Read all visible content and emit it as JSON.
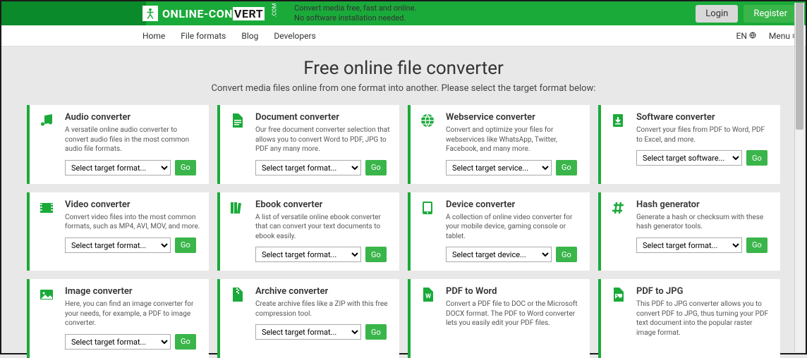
{
  "header": {
    "logo_prefix": "ONLINE-",
    "logo_con": "CON",
    "logo_vert": "VERT",
    "logo_suffix": ".COM",
    "tagline1": "Convert media free, fast and online.",
    "tagline2": "No software installation needed.",
    "login": "Login",
    "register": "Register"
  },
  "nav": {
    "home": "Home",
    "file_formats": "File formats",
    "blog": "Blog",
    "developers": "Developers",
    "lang": "EN",
    "menu": "Menu"
  },
  "hero": {
    "title": "Free online file converter",
    "subtitle": "Convert media files online from one format into another. Please select the target format below:"
  },
  "go_label": "Go",
  "cards": [
    {
      "id": "audio",
      "title": "Audio converter",
      "desc": "A versatile online audio converter to convert audio files in the most common audio file formats.",
      "placeholder": "Select target format...",
      "has_select": true
    },
    {
      "id": "document",
      "title": "Document converter",
      "desc": "Our free document converter selection that allows you to convert Word to PDF, JPG to PDF any many more.",
      "placeholder": "Select target format...",
      "has_select": true
    },
    {
      "id": "webservice",
      "title": "Webservice converter",
      "desc": "Convert and optimize your files for webservices like WhatsApp, Twitter, Facebook, and many more.",
      "placeholder": "Select target service...",
      "has_select": true
    },
    {
      "id": "software",
      "title": "Software converter",
      "desc": "Convert your files from PDF to Word, PDF to Excel, and more.",
      "placeholder": "Select target software...",
      "has_select": true
    },
    {
      "id": "video",
      "title": "Video converter",
      "desc": "Convert video files into the most common formats, such as MP4, AVI, MOV, and more.",
      "placeholder": "Select target format...",
      "has_select": true
    },
    {
      "id": "ebook",
      "title": "Ebook converter",
      "desc": "A list of versatile online ebook converter that can convert your text documents to ebook easily.",
      "placeholder": "Select target format...",
      "has_select": true
    },
    {
      "id": "device",
      "title": "Device converter",
      "desc": "A collection of online video converter for your mobile device, gaming console or tablet.",
      "placeholder": "Select target device...",
      "has_select": true
    },
    {
      "id": "hash",
      "title": "Hash generator",
      "desc": "Generate a hash or checksum with these hash generator tools.",
      "placeholder": "Select target format...",
      "has_select": true
    },
    {
      "id": "image",
      "title": "Image converter",
      "desc": "Here, you can find an image converter for your needs, for example, a PDF to image converter.",
      "placeholder": "Select target format...",
      "has_select": true
    },
    {
      "id": "archive",
      "title": "Archive converter",
      "desc": "Create archive files like a ZIP with this free compression tool.",
      "placeholder": "Select target format...",
      "has_select": true
    },
    {
      "id": "pdfword",
      "title": "PDF to Word",
      "desc": "Convert a PDF file to DOC or the Microsoft DOCX format. The PDF to Word converter lets you easily edit your PDF files.",
      "placeholder": "",
      "has_select": false
    },
    {
      "id": "pdfjpg",
      "title": "PDF to JPG",
      "desc": "This PDF to JPG converter allows you to convert PDF to JPG, thus turning your PDF text document into the popular raster image format.",
      "placeholder": "",
      "has_select": false
    }
  ],
  "icons": {
    "audio": "music-icon",
    "document": "file-icon",
    "webservice": "globe-icon",
    "software": "download-icon",
    "video": "film-icon",
    "ebook": "books-icon",
    "device": "tablet-icon",
    "hash": "hash-icon",
    "image": "picture-icon",
    "archive": "zip-icon",
    "pdfword": "word-icon",
    "pdfjpg": "jpg-icon"
  }
}
